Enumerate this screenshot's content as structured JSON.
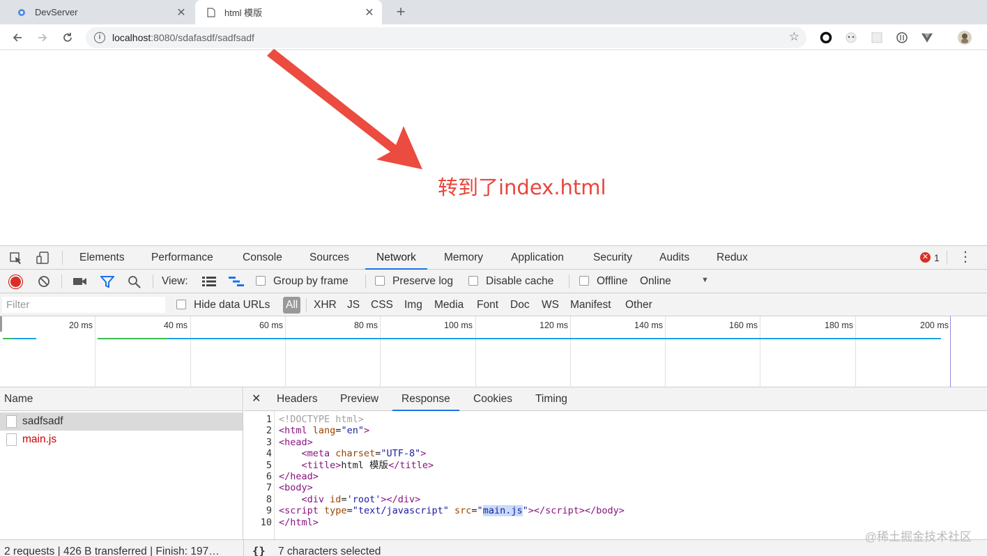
{
  "browser": {
    "tabs": [
      {
        "title": "DevServer",
        "active": false
      },
      {
        "title": "html 模版",
        "active": true
      }
    ],
    "url": {
      "host": "localhost",
      "rest": ":8080/sdafasdf/sadfsadf"
    },
    "close_glyph": "✕",
    "newtab_glyph": "+"
  },
  "annotation": {
    "text": "转到了index.html",
    "color": "#e8453c"
  },
  "devtools": {
    "tabs": [
      "Elements",
      "Performance",
      "Console",
      "Sources",
      "Network",
      "Memory",
      "Application",
      "Security",
      "Audits",
      "Redux"
    ],
    "selected_tab": "Network",
    "error_count": "1",
    "controls": {
      "view_label": "View:",
      "group_by_frame": "Group by frame",
      "preserve_log": "Preserve log",
      "disable_cache": "Disable cache",
      "offline": "Offline",
      "throttle": "Online"
    },
    "filter": {
      "placeholder": "Filter",
      "hide_data_urls": "Hide data URLs",
      "types": [
        "All",
        "XHR",
        "JS",
        "CSS",
        "Img",
        "Media",
        "Font",
        "Doc",
        "WS",
        "Manifest",
        "Other"
      ],
      "selected": "All"
    },
    "timeline_ticks": [
      "20 ms",
      "40 ms",
      "60 ms",
      "80 ms",
      "100 ms",
      "120 ms",
      "140 ms",
      "160 ms",
      "180 ms",
      "200 ms"
    ],
    "name_header": "Name",
    "requests": [
      {
        "name": "sadfsadf",
        "selected": true,
        "error": false
      },
      {
        "name": "main.js",
        "selected": false,
        "error": true
      }
    ],
    "status": "2 requests | 426 B transferred | Finish: 197…",
    "detail_tabs": [
      "Headers",
      "Preview",
      "Response",
      "Cookies",
      "Timing"
    ],
    "detail_selected": "Response",
    "code_lines": [
      "1",
      "2",
      "3",
      "4",
      "5",
      "6",
      "7",
      "8",
      "9",
      "10"
    ],
    "selection_status": "7 characters selected",
    "braces": "{}"
  },
  "watermark": "@稀土掘金技术社区"
}
